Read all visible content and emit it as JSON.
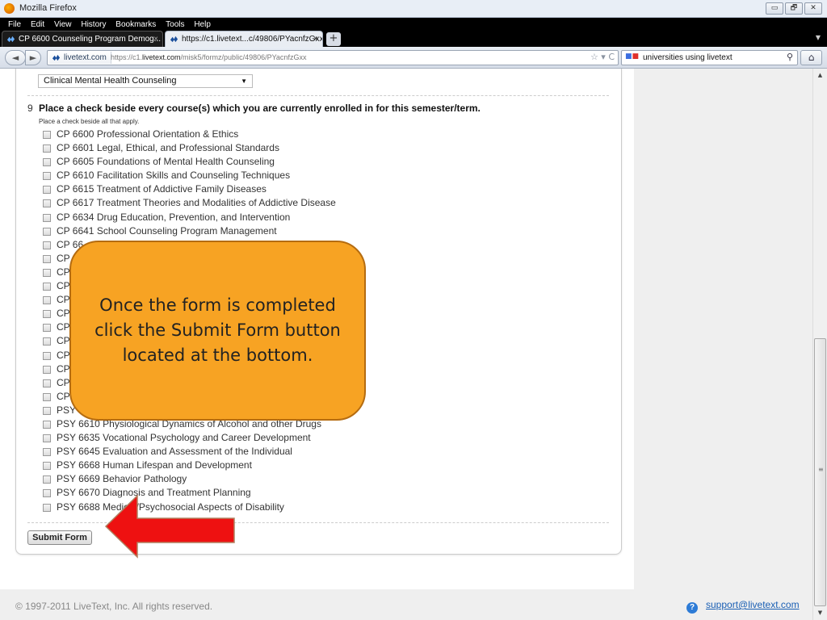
{
  "window": {
    "title": "Mozilla Firefox",
    "controls": [
      "▭",
      "🗗",
      "✕"
    ]
  },
  "menu": [
    "File",
    "Edit",
    "View",
    "History",
    "Bookmarks",
    "Tools",
    "Help"
  ],
  "tabs": [
    {
      "label": "CP 6600 Counseling Program Demog...",
      "close": "×"
    },
    {
      "label": "https://c1.livetext...c/49806/PYacnfzGxx",
      "close": "×"
    }
  ],
  "new_tab": "+",
  "nav": {
    "back": "◄",
    "forward": "►",
    "site_identity": "livetext.com",
    "url_prefix": "https://c1.",
    "url_domain": "livetext.com",
    "url_path": "/misk5/formz/public/49806/PYacnfzGxx",
    "url_icons": "☆ ▾ C",
    "search_query": "universities using livetext",
    "search_icon": "⚲",
    "home_icon": "⌂"
  },
  "form": {
    "program_select": "Clinical Mental Health Counseling",
    "question_number": "9",
    "question_text": "Place a check beside every course(s) which you are currently enrolled in for this semester/term.",
    "question_hint": "Place a check beside all that apply.",
    "courses": [
      "CP 6600 Professional Orientation & Ethics",
      "CP 6601 Legal, Ethical, and Professional Standards",
      "CP 6605 Foundations of Mental Health Counseling",
      "CP 6610 Facilitation Skills and Counseling Techniques",
      "CP 6615 Treatment of Addictive Family Diseases",
      "CP 6617 Treatment Theories and Modalities of Addictive Disease",
      "CP 6634 Drug Education, Prevention, and Intervention",
      "CP 6641 School Counseling Program Management",
      "CP 66",
      "CP",
      "CP",
      "CP",
      "CP",
      "CP",
      "CP",
      "CP",
      "CP",
      "CP",
      "CP",
      "CP",
      "PSY",
      "PSY 6610 Physiological Dynamics of Alcohol and other Drugs",
      "PSY 6635 Vocational Psychology and Career Development",
      "PSY 6645 Evaluation and Assessment of the Individual",
      "PSY 6668 Human Lifespan and Development",
      "PSY 6669 Behavior Pathology",
      "PSY 6670 Diagnosis and Treatment Planning",
      "PSY 6688 Medical/Psychosocial Aspects of Disability"
    ],
    "submit_label": "Submit Form"
  },
  "footer": {
    "copyright": "© 1997-2011 LiveText, Inc. All rights reserved.",
    "support_email": "support@livetext.com"
  },
  "callout": {
    "text": "Once the form is completed click the Submit Form button located at the bottom.",
    "fill_color": "#f7a323",
    "arrow_color": "#ee1111"
  }
}
